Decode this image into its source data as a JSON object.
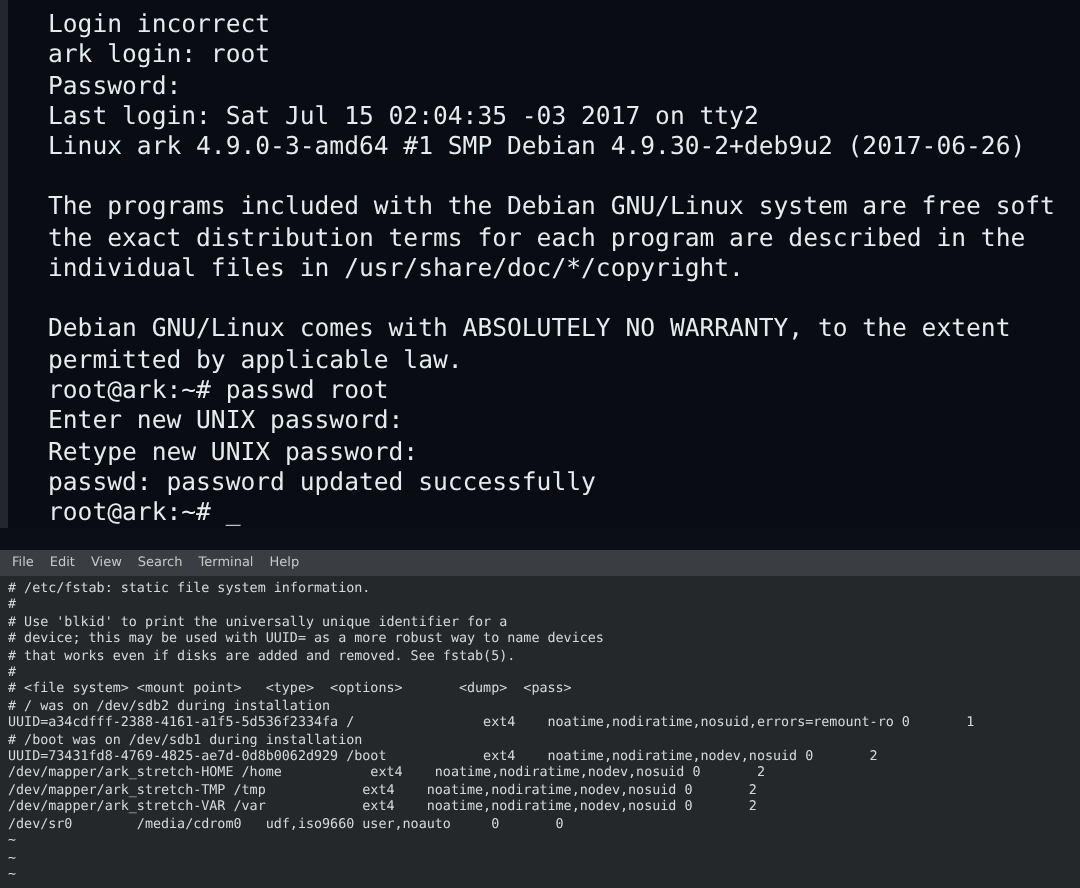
{
  "console": {
    "blocks": [
      [
        "Login incorrect",
        "ark login: root",
        "Password:",
        "Last login: Sat Jul 15 02:04:35 -03 2017 on tty2",
        "Linux ark 4.9.0-3-amd64 #1 SMP Debian 4.9.30-2+deb9u2 (2017-06-26)"
      ],
      [
        "The programs included with the Debian GNU/Linux system are free soft",
        "the exact distribution terms for each program are described in the",
        "individual files in /usr/share/doc/*/copyright."
      ],
      [
        "Debian GNU/Linux comes with ABSOLUTELY NO WARRANTY, to the extent",
        "permitted by applicable law.",
        "root@ark:~# passwd root",
        "Enter new UNIX password:",
        "Retype new UNIX password:",
        "passwd: password updated successfully",
        "root@ark:~# _"
      ]
    ]
  },
  "terminal": {
    "menu": [
      "File",
      "Edit",
      "View",
      "Search",
      "Terminal",
      "Help"
    ],
    "lines": [
      "# /etc/fstab: static file system information.",
      "#",
      "# Use 'blkid' to print the universally unique identifier for a",
      "# device; this may be used with UUID= as a more robust way to name devices",
      "# that works even if disks are added and removed. See fstab(5).",
      "#",
      "# <file system> <mount point>   <type>  <options>       <dump>  <pass>",
      "# / was on /dev/sdb2 during installation",
      "UUID=a34cdfff-2388-4161-a1f5-5d536f2334fa /                ext4    noatime,nodiratime,nosuid,errors=remount-ro 0       1",
      "# /boot was on /dev/sdb1 during installation",
      "UUID=73431fd8-4769-4825-ae7d-0d8b0062d929 /boot            ext4    noatime,nodiratime,nodev,nosuid 0       2",
      "/dev/mapper/ark_stretch-HOME /home           ext4    noatime,nodiratime,nodev,nosuid 0       2",
      "/dev/mapper/ark_stretch-TMP /tmp            ext4    noatime,nodiratime,nodev,nosuid 0       2",
      "/dev/mapper/ark_stretch-VAR /var            ext4    noatime,nodiratime,nodev,nosuid 0       2",
      "/dev/sr0        /media/cdrom0   udf,iso9660 user,noauto     0       0",
      "~",
      "~",
      "~"
    ]
  }
}
